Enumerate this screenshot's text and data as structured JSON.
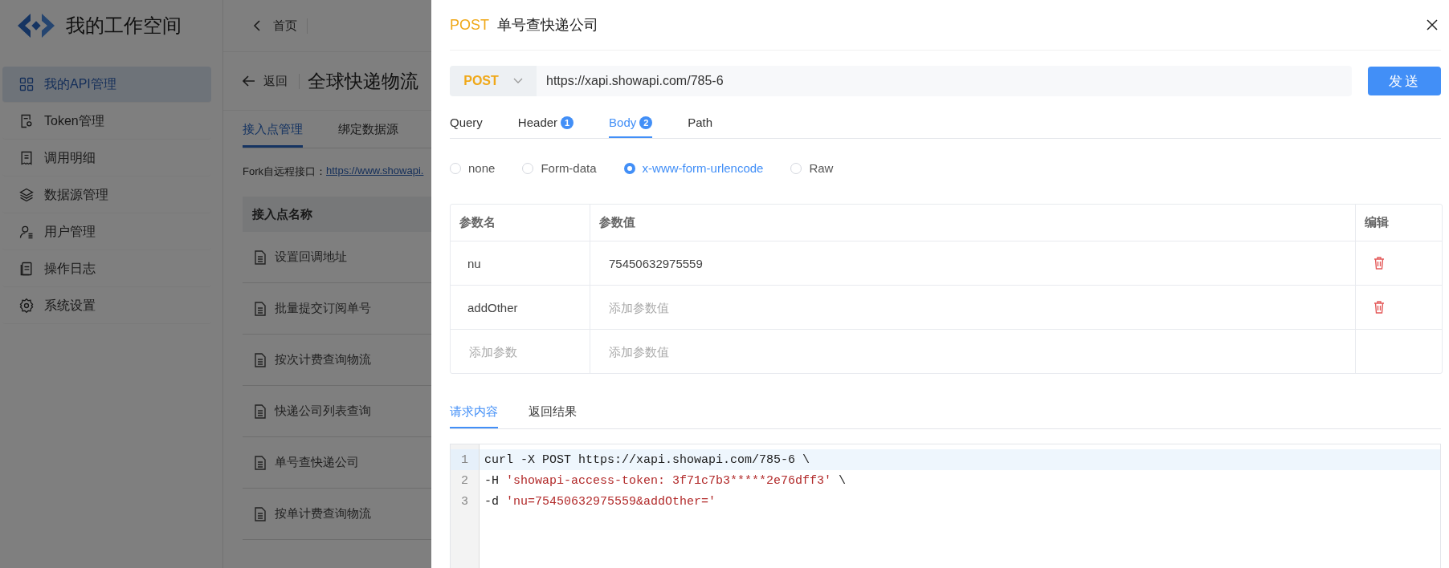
{
  "sidebar": {
    "title": "我的工作空间",
    "items": [
      {
        "label": "我的API管理",
        "selected": true
      },
      {
        "label": "Token管理",
        "selected": false
      },
      {
        "label": "调用明细",
        "selected": false
      },
      {
        "label": "数据源管理",
        "selected": false
      },
      {
        "label": "用户管理",
        "selected": false
      },
      {
        "label": "操作日志",
        "selected": false
      },
      {
        "label": "系统设置",
        "selected": false
      }
    ]
  },
  "topbar": {
    "home": "首页"
  },
  "page": {
    "back": "返回",
    "title": "全球快递物流",
    "tabs": [
      {
        "label": "接入点管理",
        "selected": true
      },
      {
        "label": "绑定数据源",
        "selected": false
      }
    ],
    "fork_label": "Fork自远程接口：",
    "fork_link": "https://www.showapi.",
    "table": {
      "column_1": "接入点名称",
      "rows": [
        "设置回调地址",
        "批量提交订阅单号",
        "按次计费查询物流",
        "快递公司列表查询",
        "单号查快递公司",
        "按单计费查询物流"
      ]
    }
  },
  "drawer": {
    "method": "POST",
    "title": "单号查快递公司",
    "method_select": "POST",
    "url": "https://xapi.showapi.com/785-6",
    "send": "发送",
    "tabs": [
      {
        "label": "Query",
        "selected": false
      },
      {
        "label": "Header",
        "badge": "1",
        "selected": false
      },
      {
        "label": "Body",
        "badge": "2",
        "selected": true
      },
      {
        "label": "Path",
        "selected": false
      }
    ],
    "body_types": [
      {
        "label": "none",
        "selected": false
      },
      {
        "label": "Form-data",
        "selected": false
      },
      {
        "label": "x-www-form-urlencode",
        "selected": true
      },
      {
        "label": "Raw",
        "selected": false
      }
    ],
    "params": {
      "columns": [
        "参数名",
        "参数值",
        "编辑"
      ],
      "rows": [
        {
          "name": "nu",
          "value": "75450632975559",
          "deletable": true
        },
        {
          "name": "addOther",
          "value_placeholder": "添加参数值",
          "deletable": true
        },
        {
          "name_placeholder": "添加参数",
          "value_placeholder": "添加参数值",
          "deletable": false
        }
      ]
    },
    "result_tabs": [
      {
        "label": "请求内容",
        "selected": true
      },
      {
        "label": "返回结果",
        "selected": false
      }
    ],
    "code": [
      {
        "number": "1",
        "highlighted": true,
        "segments": [
          {
            "kind": "plain",
            "text": "curl -X POST https://xapi.showapi.com/785-6 \\"
          }
        ]
      },
      {
        "number": "2",
        "highlighted": false,
        "segments": [
          {
            "kind": "plain",
            "text": "-H "
          },
          {
            "kind": "string",
            "text": "'showapi-access-token: 3f71c7b3*****2e76dff3'"
          },
          {
            "kind": "plain",
            "text": " \\"
          }
        ]
      },
      {
        "number": "3",
        "highlighted": false,
        "segments": [
          {
            "kind": "plain",
            "text": "-d "
          },
          {
            "kind": "string",
            "text": "'nu=75450632975559&addOther='"
          }
        ]
      }
    ]
  }
}
